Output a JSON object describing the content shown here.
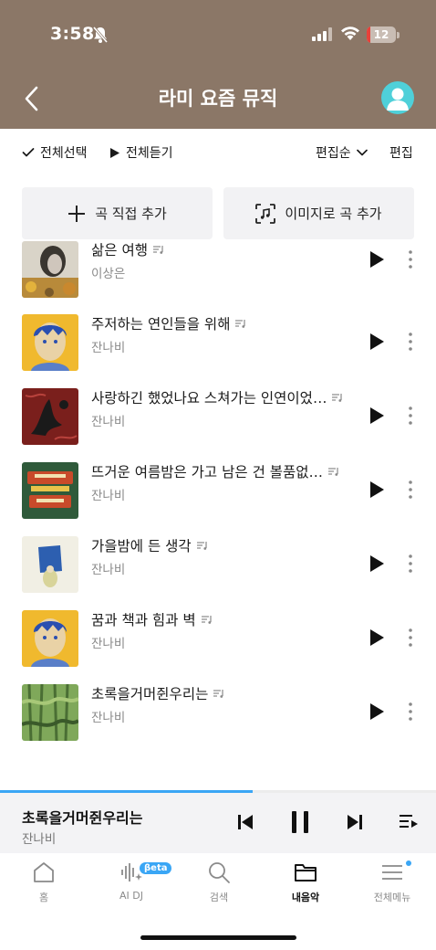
{
  "status_bar": {
    "time": "3:58",
    "battery_level": "12",
    "battery_fraction": 0.12
  },
  "header": {
    "title": "라미 요즘 뮤직"
  },
  "toolbar": {
    "select_all": "전체선택",
    "play_all": "전체듣기",
    "sort": "편집순",
    "edit": "편집"
  },
  "add_buttons": {
    "direct": "곡 직접 추가",
    "image": "이미지로 곡 추가"
  },
  "songs": [
    {
      "title": "삶은 여행",
      "artist": "이상은"
    },
    {
      "title": "주저하는 연인들을 위해",
      "artist": "잔나비"
    },
    {
      "title": "사랑하긴 했었나요 스쳐가는 인연이었…",
      "artist": "잔나비"
    },
    {
      "title": "뜨거운 여름밤은 가고 남은 건 볼품없…",
      "artist": "잔나비"
    },
    {
      "title": "가을밤에 든 생각",
      "artist": "잔나비"
    },
    {
      "title": "꿈과 책과 힘과 벽",
      "artist": "잔나비"
    },
    {
      "title": "초록을거머쥔우리는",
      "artist": "잔나비"
    }
  ],
  "now_playing": {
    "title": "초록을거머쥔우리는",
    "artist": "잔나비",
    "progress": 0.58
  },
  "tabs": [
    {
      "label": "홈",
      "icon": "home-icon"
    },
    {
      "label": "AI DJ",
      "icon": "ai-dj-icon",
      "badge": "βeta"
    },
    {
      "label": "검색",
      "icon": "search-icon"
    },
    {
      "label": "내음악",
      "icon": "folder-icon",
      "active": true
    },
    {
      "label": "전체메뉴",
      "icon": "menu-icon"
    }
  ],
  "colors": {
    "header_bg": "#8b7767",
    "accent": "#3aa6f5",
    "avatar": "#4fd0d9"
  }
}
